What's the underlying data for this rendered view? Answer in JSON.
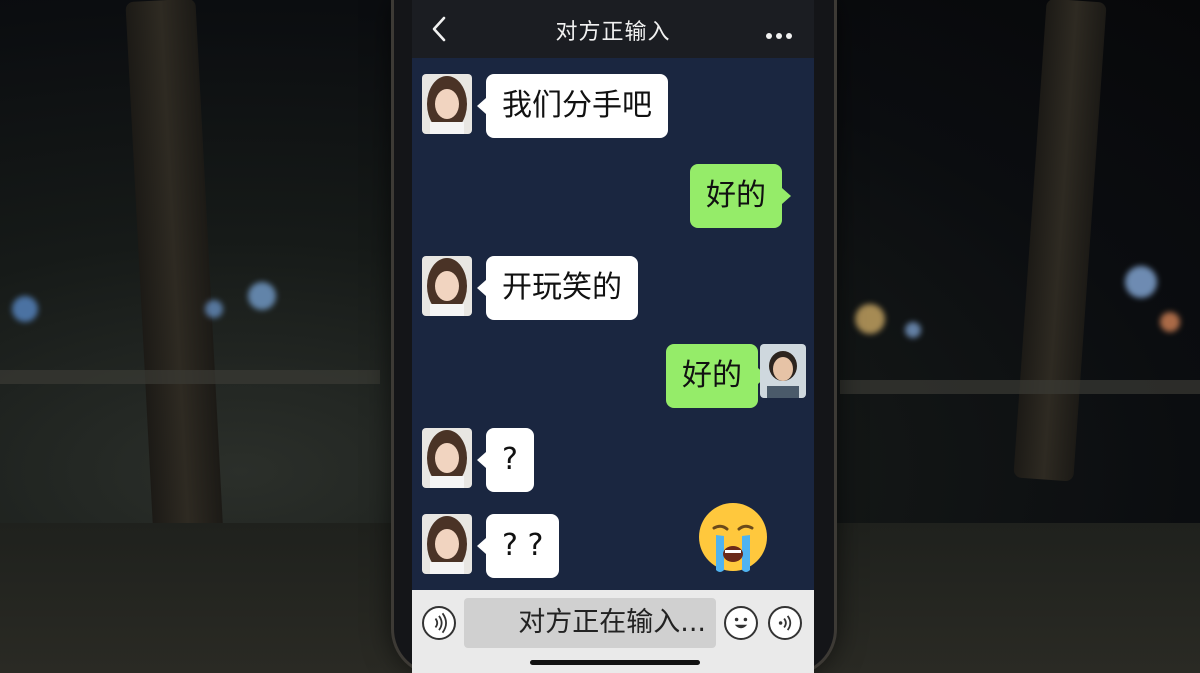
{
  "header": {
    "title": "对方正输入",
    "back_icon": "chevron-left-icon",
    "more_icon": "more-dots-icon"
  },
  "messages": [
    {
      "side": "left",
      "text": "我们分手吧"
    },
    {
      "side": "right",
      "text": "好的"
    },
    {
      "side": "left",
      "text": "开玩笑的"
    },
    {
      "side": "right",
      "text": "好的"
    },
    {
      "side": "left",
      "text": "?"
    },
    {
      "side": "left",
      "text": "? ?"
    }
  ],
  "sticker": "crying-face-emoji",
  "input_bar": {
    "voice_icon": "voice-icon",
    "input_text": "对方正在输入...",
    "emoji_icon": "smiley-icon",
    "extra_icon": "voice-wave-icon"
  },
  "colors": {
    "chat_background": "#1a2640",
    "sent_bubble": "#95ec69",
    "received_bubble": "#ffffff",
    "topbar": "#1b1d22"
  }
}
